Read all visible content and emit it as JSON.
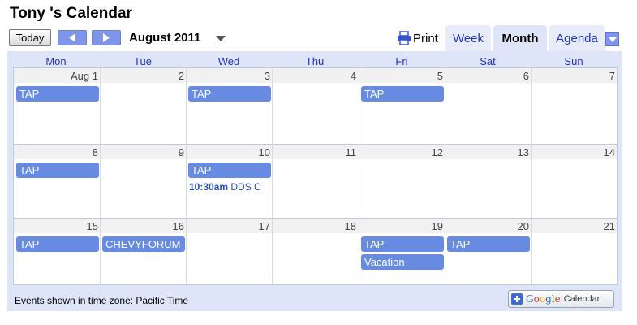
{
  "title": "Tony 's Calendar",
  "toolbar": {
    "today_label": "Today",
    "month_label": "August 2011",
    "print_label": "Print",
    "tabs": [
      "Week",
      "Month",
      "Agenda"
    ],
    "accent": "#7e95e8"
  },
  "days_of_week": [
    "Mon",
    "Tue",
    "Wed",
    "Thu",
    "Fri",
    "Sat",
    "Sun"
  ],
  "weeks": [
    {
      "days": [
        "Aug 1",
        "2",
        "3",
        "4",
        "5",
        "6",
        "7"
      ]
    },
    {
      "days": [
        "8",
        "9",
        "10",
        "11",
        "12",
        "13",
        "14"
      ]
    },
    {
      "days": [
        "15",
        "16",
        "17",
        "18",
        "19",
        "20",
        "21"
      ]
    }
  ],
  "events": {
    "w0d0": "TAP",
    "w0d2": "TAP",
    "w0d4": "TAP",
    "w1d0": "TAP",
    "w1d2": "TAP",
    "w1d2_time": "10:30am",
    "w1d2_time_title": "DDS C",
    "w2d0": "TAP",
    "w2d1": "CHEVYFORUM",
    "w2d4": "TAP",
    "w2d4b": "Vacation",
    "w2d5": "TAP"
  },
  "footer": {
    "timezone": "Events shown in time zone: Pacific Time",
    "gcal_google": "Google",
    "gcal_calendar": "Calendar"
  },
  "colors": {
    "event_bg": "#668be0",
    "panel_bg": "#dfe5f9",
    "link": "#2233bb"
  }
}
